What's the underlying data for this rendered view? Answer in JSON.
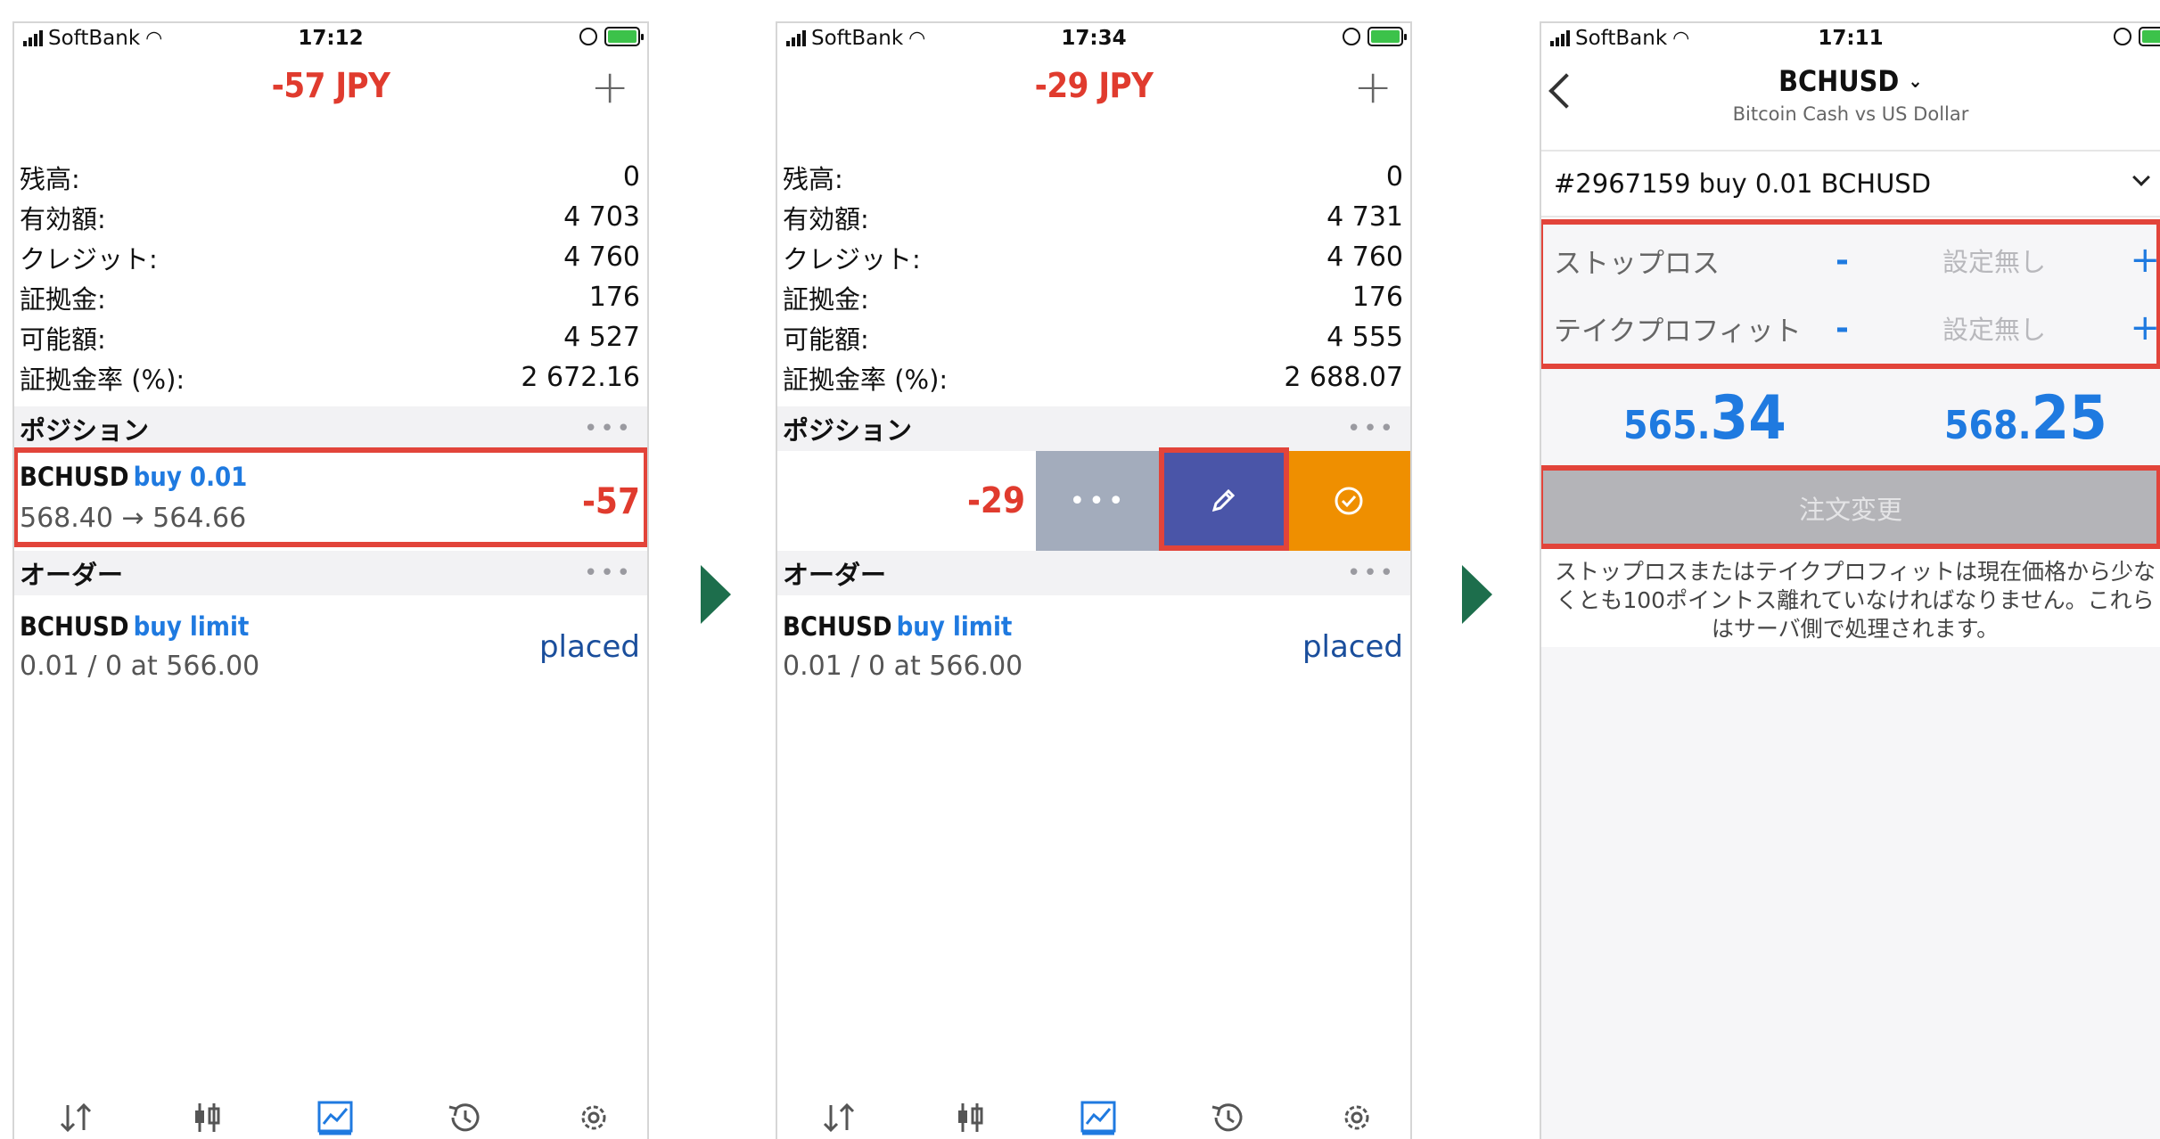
{
  "arrows": [
    "next-step",
    "next-step"
  ],
  "colors": {
    "loss": "#e03b2e",
    "blue": "#1f7ae0",
    "placed": "#1a4e9c",
    "edit": "#4a55a8",
    "close": "#ef8f00",
    "more": "#a3acbc",
    "highlight": "#e2443a",
    "arrow": "#1d6e4c"
  },
  "screen1": {
    "status": {
      "carrier": "SoftBank",
      "time": "17:12"
    },
    "title": "-57 JPY",
    "plus": "+",
    "account": [
      {
        "label": "残高:",
        "value": "0"
      },
      {
        "label": "有効額:",
        "value": "4 703"
      },
      {
        "label": "クレジット:",
        "value": "4 760"
      },
      {
        "label": "証拠金:",
        "value": "176"
      },
      {
        "label": "可能額:",
        "value": "4 527"
      },
      {
        "label": "証拠金率 (%):",
        "value": "2 672.16"
      }
    ],
    "positions_header": "ポジション",
    "position": {
      "symbol": "BCHUSD",
      "side": "buy 0.01",
      "prices": "568.40 → 564.66",
      "profit": "-57"
    },
    "orders_header": "オーダー",
    "order": {
      "symbol": "BCHUSD",
      "side": "buy limit",
      "detail": "0.01 / 0 at 566.00",
      "state": "placed"
    }
  },
  "screen2": {
    "status": {
      "carrier": "SoftBank",
      "time": "17:34"
    },
    "title": "-29 JPY",
    "plus": "+",
    "account": [
      {
        "label": "残高:",
        "value": "0"
      },
      {
        "label": "有効額:",
        "value": "4 731"
      },
      {
        "label": "クレジット:",
        "value": "4 760"
      },
      {
        "label": "証拠金:",
        "value": "176"
      },
      {
        "label": "可能額:",
        "value": "4 555"
      },
      {
        "label": "証拠金率 (%):",
        "value": "2 688.07"
      }
    ],
    "positions_header": "ポジション",
    "swipe": {
      "profit": "-29",
      "more": "•••"
    },
    "orders_header": "オーダー",
    "order": {
      "symbol": "BCHUSD",
      "side": "buy limit",
      "detail": "0.01 / 0 at 566.00",
      "state": "placed"
    }
  },
  "screen3": {
    "status": {
      "carrier": "SoftBank",
      "time": "17:11"
    },
    "symbol": "BCHUSD",
    "symbol_desc": "Bitcoin Cash vs US Dollar",
    "ticket": "#2967159 buy 0.01 BCHUSD",
    "stop_loss": {
      "label": "ストップロス",
      "value": "設定無し"
    },
    "take_profit": {
      "label": "テイクプロフィット",
      "value": "設定無し"
    },
    "bid": {
      "small": "565.",
      "large": "34"
    },
    "ask": {
      "small": "568.",
      "large": "25"
    },
    "submit": "注文変更",
    "notice": "ストップロスまたはテイクプロフィットは現在価格から少なくとも100ポイントス離れていなければなりません。これらはサーバ側で処理されます。"
  }
}
